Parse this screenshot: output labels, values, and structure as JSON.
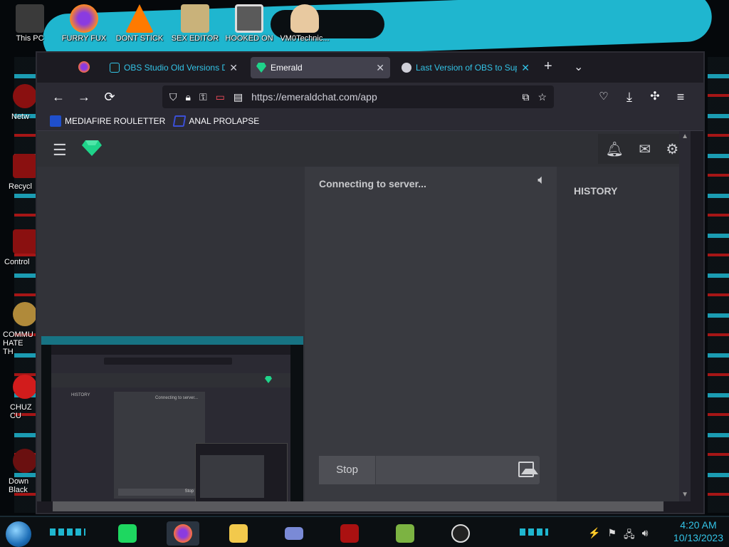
{
  "desktop": {
    "icons": [
      {
        "label": "This PC",
        "color": "#3a3a3a"
      },
      {
        "label": "FURRY FUX",
        "color": "#ff8a1e"
      },
      {
        "label": "DONT STICK",
        "color": "#ff7a00"
      },
      {
        "label": "SEX EDITOR",
        "color": "#c9b27a"
      },
      {
        "label": "HOOKED ON",
        "color": "#5a5a5a"
      },
      {
        "label": "VM0Technic...",
        "color": "#e8c9a0"
      }
    ],
    "left_icons": [
      {
        "label": "Netw"
      },
      {
        "label": "Recycl"
      },
      {
        "label": "Control"
      },
      {
        "label": "COMMU HATE TH"
      },
      {
        "label": "CHUZ CU"
      },
      {
        "label": "Down Black"
      }
    ]
  },
  "browser": {
    "tabs": [
      {
        "title": "OBS Studio Old Versions Do",
        "color": "#1e1e1e",
        "active": false
      },
      {
        "title": "Emerald",
        "color": "#1fd38a",
        "active": true
      },
      {
        "title": "Last Version of OBS to Supp",
        "color": "#cfcfd8",
        "active": false
      }
    ],
    "new_tab_icon": "plus-icon",
    "tab_list_icon": "chevron-down-icon",
    "url": "https://emeraldchat.com/app",
    "bookmarks": [
      {
        "label": "MEDIAFIRE ROULETTER",
        "color": "#1f4fcc"
      },
      {
        "label": "ANAL PROLAPSE",
        "color": "#3b4fd6"
      }
    ]
  },
  "app": {
    "status_text": "Connecting to server...",
    "stop_label": "Stop",
    "history_label": "HISTORY",
    "accent": "#1fd38a",
    "preview": {
      "status_text": "Connecting to server...",
      "history_label": "HISTORY",
      "stop_label": "Stop"
    }
  },
  "taskbar": {
    "apps": [
      {
        "name": "spotify-icon",
        "color": "#1ed760"
      },
      {
        "name": "firefox-icon",
        "color": "#ff7139"
      },
      {
        "name": "file-explorer-icon",
        "color": "#f2c94c"
      },
      {
        "name": "id-card-icon",
        "color": "#7a8ad6"
      },
      {
        "name": "game-icon",
        "color": "#a11"
      },
      {
        "name": "minecraft-icon",
        "color": "#7cb342"
      },
      {
        "name": "obs-icon",
        "color": "#dddddd"
      }
    ],
    "time": "4:20 AM",
    "date": "10/13/2023"
  }
}
